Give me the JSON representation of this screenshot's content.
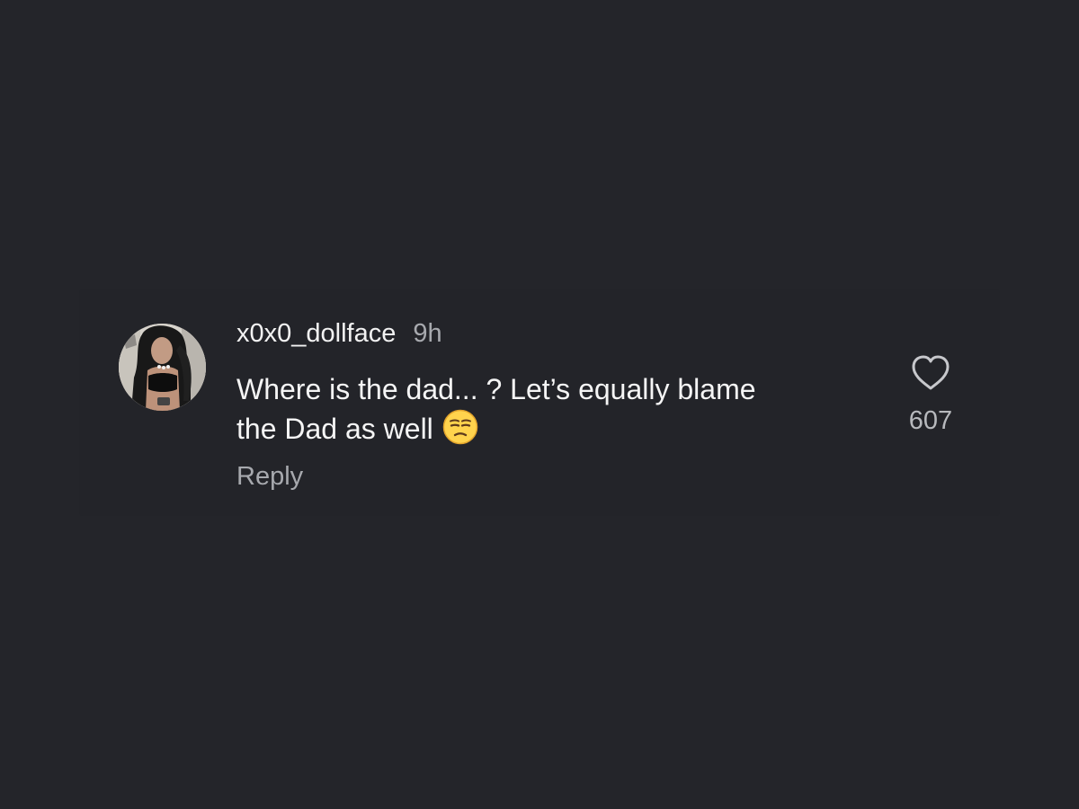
{
  "comment": {
    "username": "x0x0_dollface",
    "timestamp": "9h",
    "text_line_1": "Where is the dad... ? Let’s equally blame",
    "text_line_2": "the Dad as well",
    "emoji": "unamused-face",
    "reply_label": "Reply",
    "like_count": "607",
    "liked": false
  },
  "colors": {
    "background": "#24252a",
    "primary_text": "#f5f5f5",
    "secondary_text": "#a7a9ae",
    "like_icon": "#c7c8cc"
  }
}
